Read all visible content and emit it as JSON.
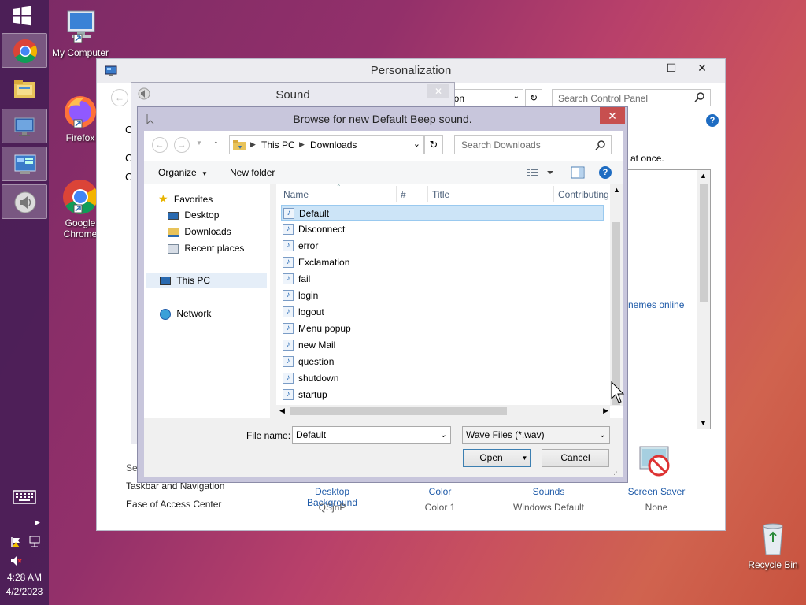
{
  "desktop": {
    "icons": [
      {
        "label": "My Computer"
      },
      {
        "label": "Firefox"
      },
      {
        "label": "Google Chrome"
      },
      {
        "label": "Recycle Bin"
      }
    ]
  },
  "taskbar": {
    "apps": [
      "chrome-icon",
      "file-explorer-icon",
      "remote-desktop-icon",
      "control-panel-icon",
      "sound-icon"
    ],
    "time": "4:28 AM",
    "date": "4/2/2023"
  },
  "personalization": {
    "title": "Personalization",
    "address_partial": "ion",
    "search_placeholder": "Search Control Panel",
    "text_fragment_1": "C",
    "text_fragment_2": "C",
    "text_fragment_3": "C",
    "text_at_once": "at once.",
    "themes_link": "nemes online",
    "see_also": "Se",
    "links": [
      "Taskbar and Navigation",
      "Ease of Access Center"
    ],
    "bottom_items": [
      {
        "label": "Desktop Background",
        "value": "QSjnP"
      },
      {
        "label": "Color",
        "value": "Color 1"
      },
      {
        "label": "Sounds",
        "value": "Windows Default"
      },
      {
        "label": "Screen Saver",
        "value": "None"
      }
    ]
  },
  "sound_dialog": {
    "title": "Sound"
  },
  "browse_dialog": {
    "title": "Browse for new Default Beep sound.",
    "breadcrumb": [
      "This PC",
      "Downloads"
    ],
    "search_placeholder": "Search Downloads",
    "organize_label": "Organize",
    "new_folder_label": "New folder",
    "nav": {
      "favorites": "Favorites",
      "items": [
        "Desktop",
        "Downloads",
        "Recent places"
      ],
      "this_pc": "This PC",
      "network": "Network"
    },
    "columns": [
      "Name",
      "#",
      "Title",
      "Contributing"
    ],
    "files": [
      "Default",
      "Disconnect",
      "error",
      "Exclamation",
      "fail",
      "login",
      "logout",
      "Menu popup",
      "new Mail",
      "question",
      "shutdown",
      "startup"
    ],
    "selected_file": "Default",
    "file_name_label": "File name:",
    "file_name_value": "Default",
    "file_type_value": "Wave Files (*.wav)",
    "open_label": "Open",
    "cancel_label": "Cancel"
  }
}
